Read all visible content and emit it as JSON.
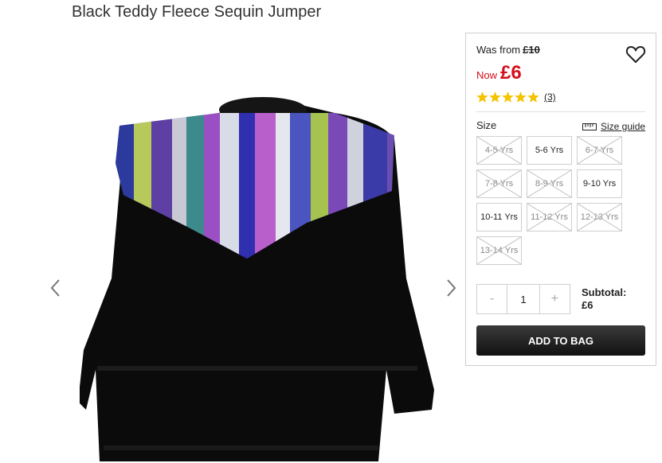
{
  "product": {
    "title": "Black Teddy Fleece Sequin Jumper"
  },
  "gallery": {
    "prev_icon": "chevron-left-icon",
    "next_icon": "chevron-right-icon"
  },
  "price": {
    "was_label": "Was from",
    "was_price": "£10",
    "now_label": "Now",
    "now_price": "£6",
    "accent": "#d40f1b"
  },
  "rating": {
    "stars": 5,
    "count": "(3)",
    "star_color": "#f5c300"
  },
  "size": {
    "label": "Size",
    "guide_label": "Size guide",
    "options": [
      {
        "label": "4-5 Yrs",
        "available": false
      },
      {
        "label": "5-6 Yrs",
        "available": true
      },
      {
        "label": "6-7 Yrs",
        "available": false
      },
      {
        "label": "7-8 Yrs",
        "available": false
      },
      {
        "label": "8-9 Yrs",
        "available": false
      },
      {
        "label": "9-10 Yrs",
        "available": true
      },
      {
        "label": "10-11 Yrs",
        "available": true
      },
      {
        "label": "11-12 Yrs",
        "available": false
      },
      {
        "label": "12-13 Yrs",
        "available": false
      },
      {
        "label": "13-14 Yrs",
        "available": false
      }
    ]
  },
  "quantity": {
    "minus": "-",
    "value": "1",
    "plus": "+"
  },
  "subtotal": {
    "label": "Subtotal:",
    "value": "£6"
  },
  "cart": {
    "add_label": "ADD TO BAG"
  }
}
